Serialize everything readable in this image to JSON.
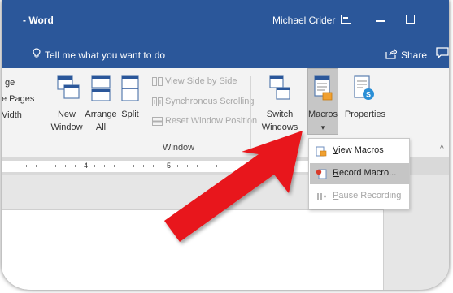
{
  "titlebar": {
    "doc_title": "- Word",
    "user_name": "Michael Crider",
    "icons": [
      "ribbon-display-options-icon",
      "minimize-icon",
      "maximize-icon"
    ]
  },
  "tellbar": {
    "tell_me_text": "Tell me what you want to do",
    "share_label": "Share",
    "icons": [
      "lightbulb-icon",
      "share-icon",
      "comment-icon"
    ]
  },
  "ribbon": {
    "cut_labels": [
      "ge",
      "e Pages",
      "Vidth"
    ],
    "new_window": [
      "New",
      "Window"
    ],
    "arrange_all": [
      "Arrange",
      "All"
    ],
    "split": "Split",
    "view_side_by_side": "View Side by Side",
    "synchronous_scrolling": "Synchronous Scrolling",
    "reset_window_position": "Reset Window Position",
    "switch_windows": [
      "Switch",
      "Windows"
    ],
    "macros": "Macros",
    "macros_dropdown_glyph": "▾",
    "properties": "Properties",
    "group_label": "Window",
    "collapse_glyph": "^"
  },
  "ruler": {
    "numbers": [
      "4",
      "5"
    ]
  },
  "macros_menu": {
    "items": [
      {
        "text": "iew Macros",
        "accel": "V",
        "icon": "view-macros-icon",
        "state": "normal"
      },
      {
        "text": "ecord Macro...",
        "accel": "R",
        "icon": "record-macro-icon",
        "state": "hover"
      },
      {
        "text": "ause Recording",
        "accel": "P",
        "icon": "pause-recording-icon",
        "state": "disabled"
      }
    ]
  },
  "colors": {
    "title_blue": "#2b579a",
    "ribbon_bg": "#f3f3f3",
    "arrow_red": "#e8191b",
    "menu_hover": "#c5c5c5"
  }
}
